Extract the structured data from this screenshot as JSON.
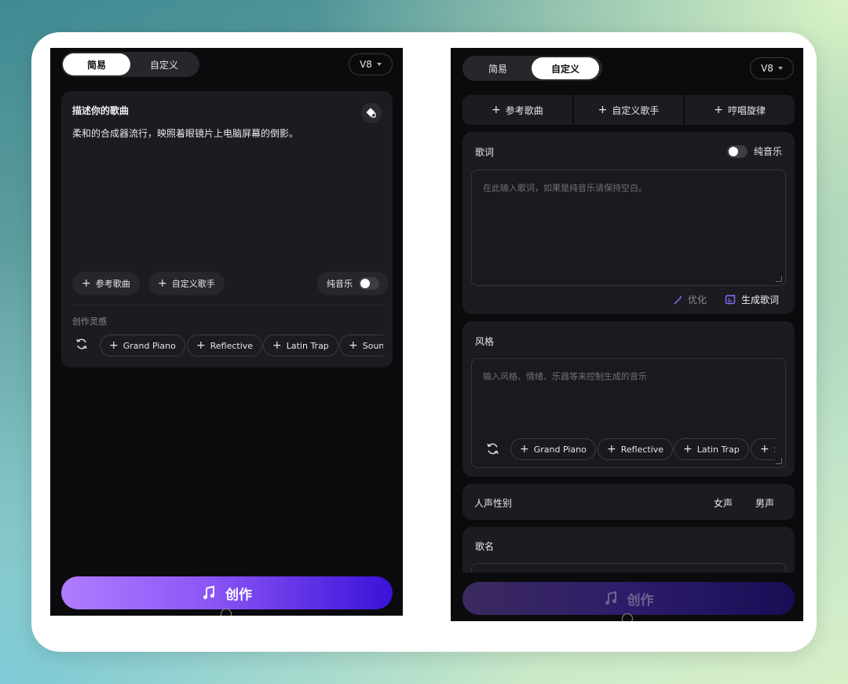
{
  "left": {
    "tabs": [
      "简易",
      "自定义"
    ],
    "active_tab": 0,
    "version": "V8",
    "describe_title": "描述你的歌曲",
    "describe_text": "柔和的合成器流行，映照着眼镜片上电脑屏幕的倒影。",
    "ref_song": "参考歌曲",
    "custom_singer": "自定义歌手",
    "pure_music": "纯音乐",
    "inspiration_title": "创作灵感",
    "tags": [
      "Grand Piano",
      "Reflective",
      "Latin Trap",
      "Soun"
    ],
    "create_label": "创作"
  },
  "right": {
    "tabs": [
      "简易",
      "自定义"
    ],
    "active_tab": 1,
    "version": "V8",
    "top_actions": [
      "参考歌曲",
      "自定义歌手",
      "哼唱旋律"
    ],
    "lyrics_title": "歌词",
    "pure_music": "纯音乐",
    "lyrics_placeholder": "在此输入歌词，如果是纯音乐请保持空白。",
    "optimize_label": "优化",
    "generate_lyrics_label": "生成歌词",
    "style_title": "风格",
    "style_placeholder": "输入风格、情绪、乐器等来控制生成的音乐",
    "tags": [
      "Grand Piano",
      "Reflective",
      "Latin Trap",
      "S"
    ],
    "voice_title": "人声性别",
    "voice_options": [
      "女声",
      "男声"
    ],
    "song_name_title": "歌名",
    "create_label": "创作"
  },
  "colors": {
    "panel_bg": "#0b0b0d",
    "card_bg": "#1c1c20",
    "accent_gradient_start": "#a66bff",
    "accent_gradient_end": "#3a12d8",
    "accent_icon": "#8a6cff"
  }
}
